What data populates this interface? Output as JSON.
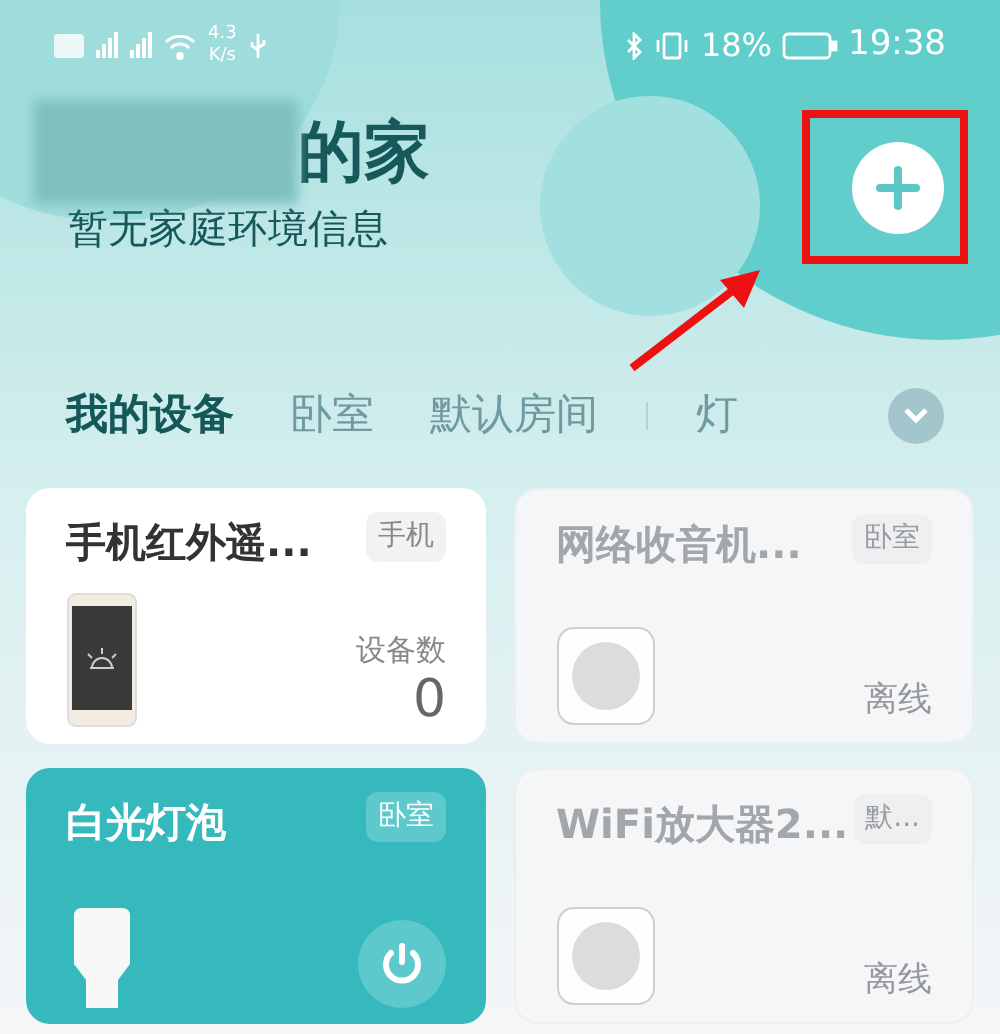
{
  "status_bar": {
    "network_speed": "4.3",
    "speed_unit": "K/s",
    "battery": "18%",
    "time": "19:38"
  },
  "home": {
    "title": "的家",
    "subtitle": "暂无家庭环境信息"
  },
  "tabs": [
    {
      "label": "我的设备",
      "selected": true
    },
    {
      "label": "卧室",
      "selected": false
    },
    {
      "label": "默认房间",
      "selected": false
    },
    {
      "label": "灯",
      "selected": false
    }
  ],
  "devices": [
    {
      "name": "手机红外遥...",
      "room": "手机",
      "kind": "stat",
      "offline": false,
      "on": false,
      "stat_label": "设备数",
      "stat_value": "0"
    },
    {
      "name": "网络收音机...",
      "room": "卧室",
      "kind": "status",
      "offline": true,
      "on": false,
      "status": "离线"
    },
    {
      "name": "白光灯泡",
      "room": "卧室",
      "kind": "power",
      "offline": false,
      "on": true
    },
    {
      "name": "WiFi放大器2...",
      "room": "默...",
      "kind": "status",
      "offline": true,
      "on": false,
      "status": "离线"
    }
  ]
}
